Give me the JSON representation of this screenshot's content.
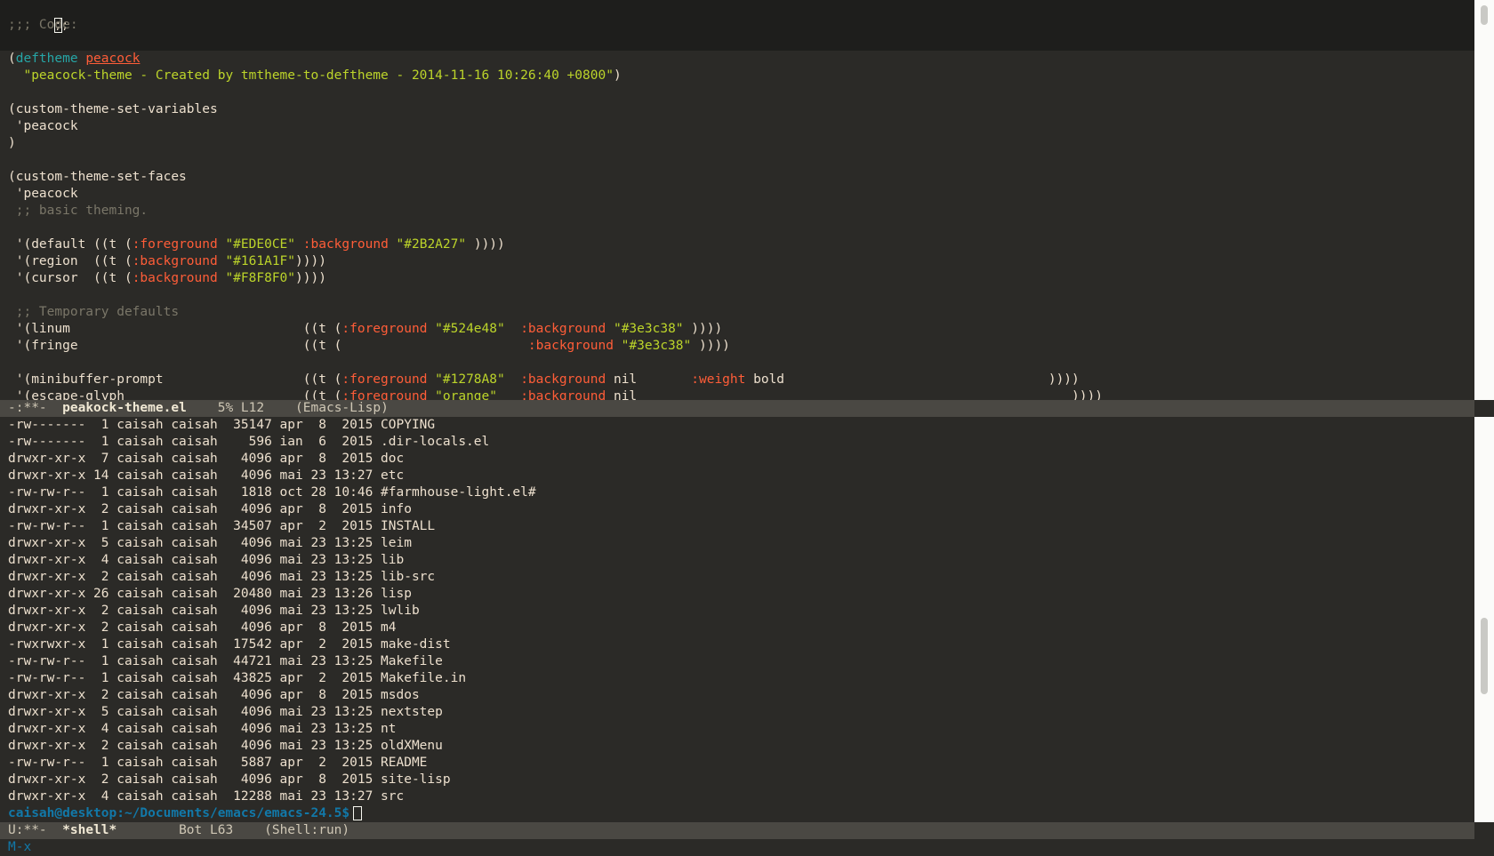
{
  "upper_buffer": {
    "lines": [
      {
        "parts": [
          {
            "t": ";;; Code:",
            "c": "comment"
          }
        ]
      },
      {
        "parts": []
      },
      {
        "parts": [
          {
            "t": "(",
            "c": ""
          },
          {
            "t": "deftheme",
            "c": "keyword"
          },
          {
            "t": " ",
            "c": ""
          },
          {
            "t": "peacock",
            "c": "fname"
          }
        ]
      },
      {
        "parts": [
          {
            "t": "  ",
            "c": ""
          },
          {
            "t": "\"peacock-theme - Created by tmtheme-to-deftheme - 2014-11-16 10:26:40 +0800\"",
            "c": "string"
          },
          {
            "t": ")",
            "c": ""
          }
        ]
      },
      {
        "parts": []
      },
      {
        "parts": [
          {
            "t": "(custom-theme-set-variables",
            "c": ""
          }
        ]
      },
      {
        "parts": [
          {
            "t": " 'peacock",
            "c": ""
          }
        ]
      },
      {
        "parts": [
          {
            "t": ")",
            "c": ""
          }
        ]
      },
      {
        "parts": []
      },
      {
        "parts": [
          {
            "t": "(custom-theme-set-faces",
            "c": ""
          }
        ]
      },
      {
        "parts": [
          {
            "t": " 'peacock",
            "c": ""
          }
        ]
      },
      {
        "parts": [
          {
            "t": " ;; basic theming.",
            "c": "comment"
          }
        ]
      },
      {
        "parts": []
      },
      {
        "parts": [
          {
            "t": " '(default ((t (",
            "c": ""
          },
          {
            "t": ":foreground",
            "c": "prop"
          },
          {
            "t": " ",
            "c": ""
          },
          {
            "t": "\"#EDE0CE\"",
            "c": "string"
          },
          {
            "t": " ",
            "c": ""
          },
          {
            "t": ":background",
            "c": "prop"
          },
          {
            "t": " ",
            "c": ""
          },
          {
            "t": "\"#2B2A27\"",
            "c": "string"
          },
          {
            "t": " ))))",
            "c": ""
          }
        ]
      },
      {
        "parts": [
          {
            "t": " '(region  ((t (",
            "c": ""
          },
          {
            "t": ":background",
            "c": "prop"
          },
          {
            "t": " ",
            "c": ""
          },
          {
            "t": "\"#161A1F\"",
            "c": "string"
          },
          {
            "t": "))))",
            "c": ""
          }
        ]
      },
      {
        "parts": [
          {
            "t": " '(cursor  ((t (",
            "c": ""
          },
          {
            "t": ":background",
            "c": "prop"
          },
          {
            "t": " ",
            "c": ""
          },
          {
            "t": "\"#F8F8F0\"",
            "c": "string"
          },
          {
            "t": "))))",
            "c": ""
          }
        ]
      },
      {
        "parts": []
      },
      {
        "parts": [
          {
            "t": " ;; Temporary defaults",
            "c": "comment"
          }
        ]
      },
      {
        "parts": [
          {
            "t": " '(linum                              ((t (",
            "c": ""
          },
          {
            "t": ":foreground",
            "c": "prop"
          },
          {
            "t": " ",
            "c": ""
          },
          {
            "t": "\"#524e48\"",
            "c": "string"
          },
          {
            "t": "  ",
            "c": ""
          },
          {
            "t": ":background",
            "c": "prop"
          },
          {
            "t": " ",
            "c": ""
          },
          {
            "t": "\"#3e3c38\"",
            "c": "string"
          },
          {
            "t": " ))))",
            "c": ""
          }
        ]
      },
      {
        "parts": [
          {
            "t": " '(fringe                             ((t (                        ",
            "c": ""
          },
          {
            "t": ":background",
            "c": "prop"
          },
          {
            "t": " ",
            "c": ""
          },
          {
            "t": "\"#3e3c38\"",
            "c": "string"
          },
          {
            "t": " ))))",
            "c": ""
          }
        ]
      },
      {
        "parts": []
      },
      {
        "parts": [
          {
            "t": " '(minibuffer-prompt                  ((t (",
            "c": ""
          },
          {
            "t": ":foreground",
            "c": "prop"
          },
          {
            "t": " ",
            "c": ""
          },
          {
            "t": "\"#1278A8\"",
            "c": "string"
          },
          {
            "t": "  ",
            "c": ""
          },
          {
            "t": ":background",
            "c": "prop"
          },
          {
            "t": " nil       ",
            "c": ""
          },
          {
            "t": ":weight",
            "c": "prop"
          },
          {
            "t": " bold                                  ))))",
            "c": ""
          }
        ]
      },
      {
        "parts": [
          {
            "t": " '(escape-glyph                       ((t (",
            "c": ""
          },
          {
            "t": ":foreground",
            "c": "prop"
          },
          {
            "t": " ",
            "c": ""
          },
          {
            "t": "\"orange\"",
            "c": "string"
          },
          {
            "t": "   ",
            "c": ""
          },
          {
            "t": ":background",
            "c": "prop"
          },
          {
            "t": " nil                                                        ))))",
            "c": ""
          }
        ]
      }
    ],
    "first_line_text": ";;"
  },
  "upper_modeline": {
    "status": "-:**-",
    "buffer_name": "peakock-theme.el",
    "position": "5% L12",
    "mode": "(Emacs-Lisp)"
  },
  "shell_buffer": {
    "listing": [
      "-rw-------  1 caisah caisah  35147 apr  8  2015 COPYING",
      "-rw-------  1 caisah caisah    596 ian  6  2015 .dir-locals.el",
      "drwxr-xr-x  7 caisah caisah   4096 apr  8  2015 doc",
      "drwxr-xr-x 14 caisah caisah   4096 mai 23 13:27 etc",
      "-rw-rw-r--  1 caisah caisah   1818 oct 28 10:46 #farmhouse-light.el#",
      "drwxr-xr-x  2 caisah caisah   4096 apr  8  2015 info",
      "-rw-rw-r--  1 caisah caisah  34507 apr  2  2015 INSTALL",
      "drwxr-xr-x  5 caisah caisah   4096 mai 23 13:25 leim",
      "drwxr-xr-x  4 caisah caisah   4096 mai 23 13:25 lib",
      "drwxr-xr-x  2 caisah caisah   4096 mai 23 13:25 lib-src",
      "drwxr-xr-x 26 caisah caisah  20480 mai 23 13:26 lisp",
      "drwxr-xr-x  2 caisah caisah   4096 mai 23 13:25 lwlib",
      "drwxr-xr-x  2 caisah caisah   4096 apr  8  2015 m4",
      "-rwxrwxr-x  1 caisah caisah  17542 apr  2  2015 make-dist",
      "-rw-rw-r--  1 caisah caisah  44721 mai 23 13:25 Makefile",
      "-rw-rw-r--  1 caisah caisah  43825 apr  2  2015 Makefile.in",
      "drwxr-xr-x  2 caisah caisah   4096 apr  8  2015 msdos",
      "drwxr-xr-x  5 caisah caisah   4096 mai 23 13:25 nextstep",
      "drwxr-xr-x  4 caisah caisah   4096 mai 23 13:25 nt",
      "drwxr-xr-x  2 caisah caisah   4096 mai 23 13:25 oldXMenu",
      "-rw-rw-r--  1 caisah caisah   5887 apr  2  2015 README",
      "drwxr-xr-x  2 caisah caisah   4096 apr  8  2015 site-lisp",
      "drwxr-xr-x  4 caisah caisah  12288 mai 23 13:27 src"
    ],
    "prompt": "caisah@desktop:~/Documents/emacs/emacs-24.5$"
  },
  "lower_modeline": {
    "status": "U:**-",
    "buffer_name": "*shell*",
    "position": "Bot L63",
    "mode": "(Shell:run)"
  },
  "minibuffer": {
    "text": "M-x"
  },
  "colors": {
    "background": "#2B2A27",
    "foreground": "#EDE0CE",
    "keyword": "#26A6A6",
    "string": "#BCD42A",
    "property": "#FF5D38",
    "prompt": "#1278A8",
    "modeline": "#4a4843"
  }
}
